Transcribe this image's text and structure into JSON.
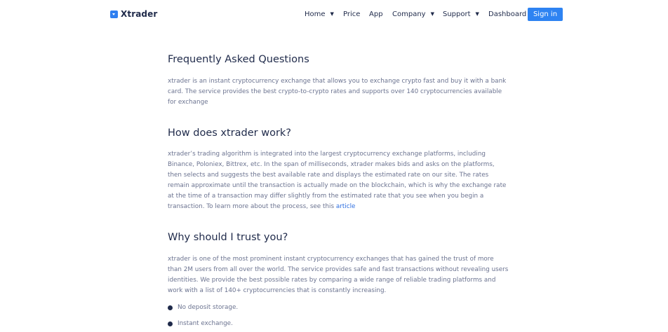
{
  "header": {
    "brand": "Xtrader",
    "nav": [
      {
        "label": "Home",
        "has_dropdown": true
      },
      {
        "label": "Price",
        "has_dropdown": false
      },
      {
        "label": "App",
        "has_dropdown": false
      },
      {
        "label": "Company",
        "has_dropdown": true
      },
      {
        "label": "Support",
        "has_dropdown": true
      },
      {
        "label": "Dashboard",
        "has_dropdown": false
      }
    ],
    "sign_in_label": "Sign in"
  },
  "faq": {
    "title": "Frequently Asked Questions",
    "intro": "xtrader is an instant cryptocurrency exchange that allows you to exchange crypto fast and buy it with a bank card. The service provides the best crypto-to-crypto rates and supports over 140 cryptocurrencies available for exchange"
  },
  "how": {
    "title": "How does xtrader work?",
    "body": "xtrader’s trading algorithm is integrated into the largest cryptocurrency exchange platforms, including Binance, Poloniex, Bittrex, etc. In the span of milliseconds, xtrader makes bids and asks on the platforms, then selects and suggests the best available rate and displays the estimated rate on our site. The rates remain approximate until the transaction is actually made on the blockchain, which is why the exchange rate at the time of a transaction may differ slightly from the estimated rate that you see when you begin a transaction. To learn more about the process, see this",
    "link_label": "article"
  },
  "trust": {
    "title": "Why should I trust you?",
    "body": "xtrader is one of the most prominent instant cryptocurrency exchanges that has gained the trust of more than 2M users from all over the world. The service provides safe and fast transactions without revealing users identities. We provide the best possible rates by comparing a wide range of reliable trading platforms and work with a list of 140+ cryptocurrencies that is constantly increasing.",
    "bullets": [
      "No deposit storage.",
      "Instant exchange."
    ]
  },
  "colors": {
    "accent": "#2e83f2",
    "heading": "#1f2a4a",
    "body_text": "#6b7390",
    "link": "#2e6fe0"
  }
}
